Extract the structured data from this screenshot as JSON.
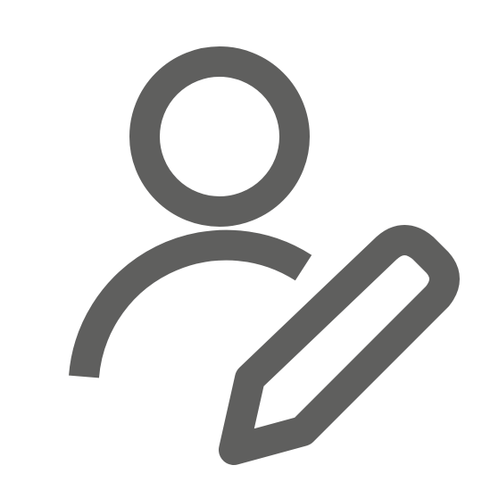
{
  "icon": {
    "name": "edit-user-icon",
    "parts": [
      "user-head",
      "user-shoulders",
      "pencil"
    ],
    "color": "#5f5f5e",
    "background": "#ffffff"
  }
}
